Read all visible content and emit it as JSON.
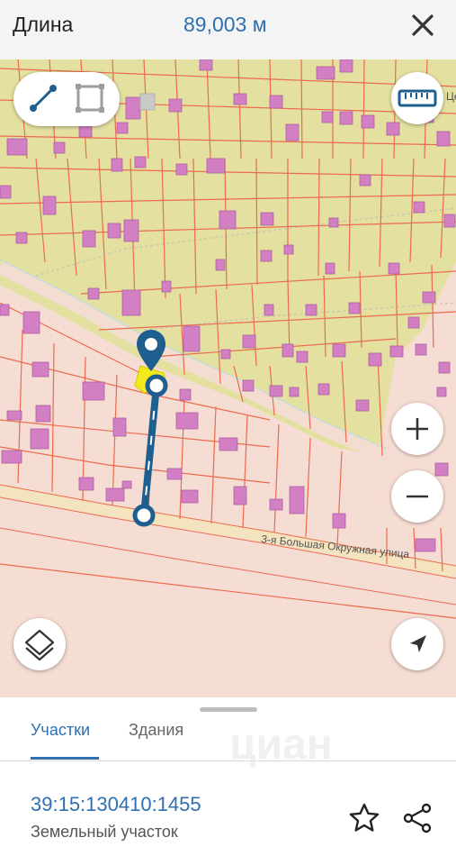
{
  "header": {
    "title": "Длина",
    "value": "89,003 м"
  },
  "map": {
    "street_label": "3-я Большая Окружная улица",
    "street_partial": "Це"
  },
  "tabs": [
    "Участки",
    "Здания"
  ],
  "parcel": {
    "cadastral_number": "39:15:130410:1455",
    "type": "Земельный участок"
  },
  "watermark": "циан",
  "colors": {
    "accent": "#2f6fb2",
    "measure_line": "#1f5f8f",
    "zone_green": "#e3e0a0",
    "zone_pink": "#f6ddd3",
    "building": "#d27fc4",
    "parcel_border": "#ec6a4f"
  }
}
